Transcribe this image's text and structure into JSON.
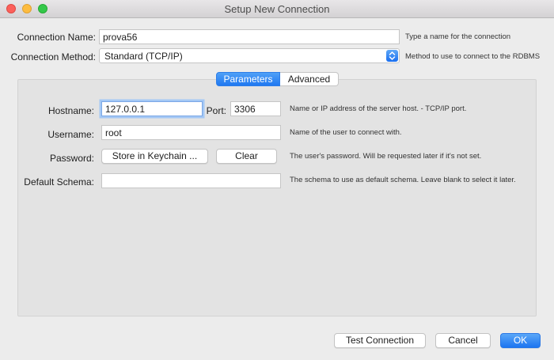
{
  "window": {
    "title": "Setup New Connection"
  },
  "connection_name": {
    "label": "Connection Name:",
    "value": "prova56",
    "hint": "Type a name for the connection"
  },
  "connection_method": {
    "label": "Connection Method:",
    "value": "Standard (TCP/IP)",
    "hint": "Method to use to connect to the RDBMS"
  },
  "tabs": {
    "parameters": "Parameters",
    "advanced": "Advanced"
  },
  "params": {
    "hostname": {
      "label": "Hostname:",
      "value": "127.0.0.1"
    },
    "port": {
      "label": "Port:",
      "value": "3306"
    },
    "hostname_hint": "Name or IP address of the server host. - TCP/IP port.",
    "username": {
      "label": "Username:",
      "value": "root",
      "hint": "Name of the user to connect with."
    },
    "password": {
      "label": "Password:",
      "store_button": "Store in Keychain ...",
      "clear_button": "Clear",
      "hint": "The user's password. Will be requested later if it's not set."
    },
    "schema": {
      "label": "Default Schema:",
      "value": "",
      "hint": "The schema to use as default schema. Leave blank to select it later."
    }
  },
  "footer": {
    "test": "Test Connection",
    "cancel": "Cancel",
    "ok": "OK"
  },
  "colors": {
    "accent": "#1f78f1",
    "panel": "#e3e3e3",
    "background": "#ececec"
  }
}
